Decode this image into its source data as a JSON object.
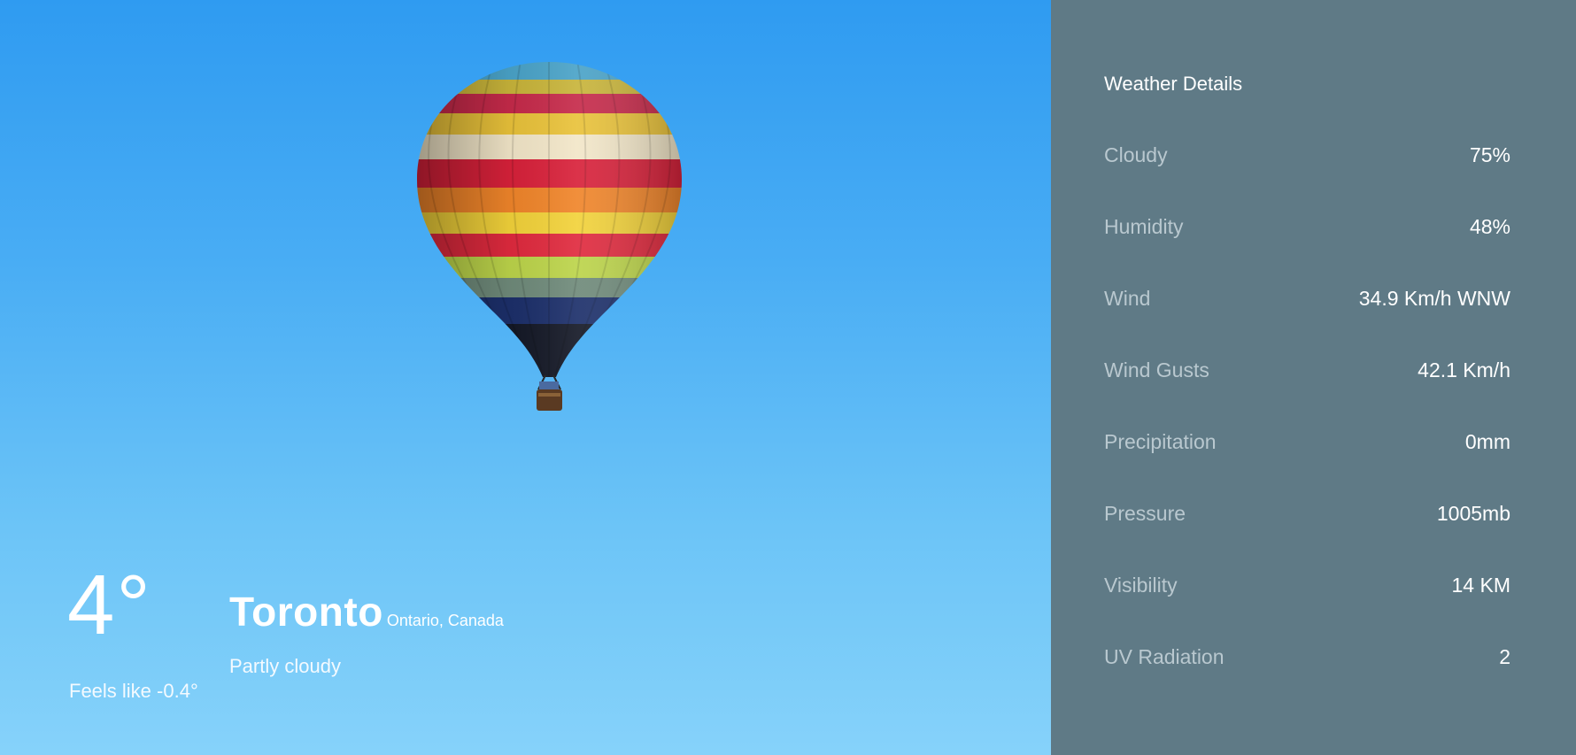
{
  "current": {
    "temperature": "4°",
    "feels_like": "Feels like -0.4°",
    "city": "Toronto",
    "region": "Ontario, Canada",
    "condition": "Partly cloudy"
  },
  "details": {
    "title": "Weather Details",
    "rows": [
      {
        "label": "Cloudy",
        "value": "75%"
      },
      {
        "label": "Humidity",
        "value": "48%"
      },
      {
        "label": "Wind",
        "value": "34.9 Km/h WNW"
      },
      {
        "label": "Wind Gusts",
        "value": "42.1 Km/h"
      },
      {
        "label": "Precipitation",
        "value": "0mm"
      },
      {
        "label": "Pressure",
        "value": "1005mb"
      },
      {
        "label": "Visibility",
        "value": "14 KM"
      },
      {
        "label": "UV Radiation",
        "value": "2"
      }
    ]
  },
  "colors": {
    "sky_top": "#2f9bf1",
    "sky_bottom": "#86d2fa",
    "panel_bg": "#5f7a86",
    "label_text": "#b9c8cf",
    "value_text": "#ffffff"
  },
  "background_image": "hot-air-balloon"
}
